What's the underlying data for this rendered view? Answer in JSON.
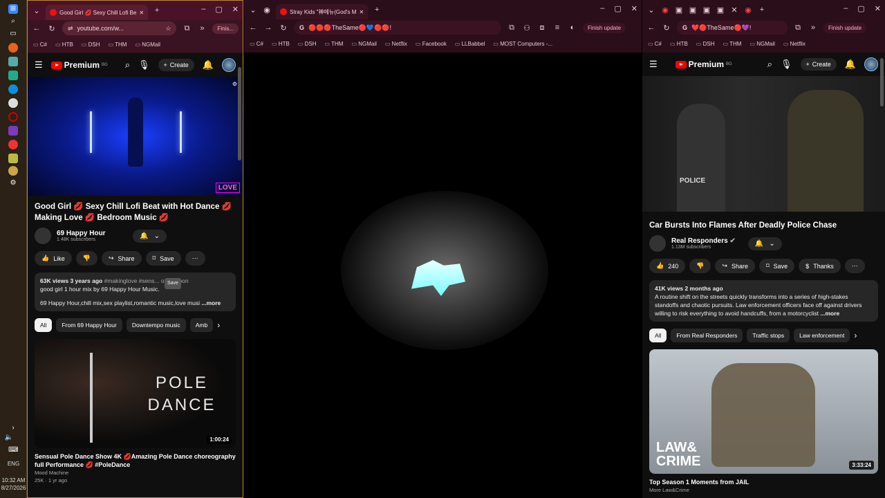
{
  "taskbar": {
    "time": "10:32 AM",
    "date": "8/27/2026",
    "lang": "ENG"
  },
  "win1": {
    "tab_title": "Good Girl 💋 Sexy Chill Lofi Be",
    "url": "youtube.com/w...",
    "finish": "Finis...",
    "bookmarks": [
      "C#",
      "HTB",
      "DSH",
      "THM",
      "NGMail"
    ],
    "brand": "Premium",
    "brand_sup": "BG",
    "create": "Create",
    "title": "Good Girl 💋 Sexy Chill Lofi Beat with Hot Dance 💋 Making Love 💋 Bedroom Music 💋",
    "channel": "69 Happy Hour",
    "subs": "1.48K subscribers",
    "like": "Like",
    "share": "Share",
    "save": "Save",
    "desc_stats": "63K views  3 years ago",
    "desc_tags": "#makinglove #sens... oneymoon",
    "desc_line2": "good girl 1 hour mix by 69 Happy Hour Music.",
    "desc_line3": "69 Happy Hour,chill mix,sex playlist,romantic music,love musi",
    "more": "...more",
    "chips": [
      "All",
      "From 69 Happy Hour",
      "Downtempo music",
      "Amb"
    ],
    "next": {
      "title": "Sensual Pole Dance Show 4K 💋Amazing Pole Dance choreography full Performance 💋 #PoleDance",
      "channel": "Mood Machine",
      "meta": "25K · 1 yr ago",
      "duration": "1:00:24",
      "thumb_text": "POLE DANCE"
    },
    "tooltip": "Save",
    "badge": "LOVE"
  },
  "win2": {
    "tab_title": "Stray Kids \"神메뉴(God's M",
    "omni": "🔴🔴🔴TheSame🔴💙🔴🔴!",
    "finish": "Finish update",
    "bookmarks": [
      "C#",
      "HTB",
      "DSH",
      "THM",
      "NGMail",
      "Netflix",
      "Facebook",
      "LLBabbel",
      "MOST Computers -..."
    ]
  },
  "win3": {
    "omni": "❤️🔴TheSame🔴💜!",
    "finish": "Finish update",
    "bookmarks": [
      "C#",
      "HTB",
      "DSH",
      "THM",
      "NGMail",
      "Netflix"
    ],
    "brand": "Premium",
    "brand_sup": "BG",
    "create": "Create",
    "title": "Car Bursts Into Flames After Deadly Police Chase",
    "channel": "Real Responders",
    "subs": "1.13M subscribers",
    "likes": "240",
    "share": "Share",
    "save": "Save",
    "thanks": "Thanks",
    "desc_stats": "41K views  2 months ago",
    "desc_text": "A routine shift on the streets quickly transforms into a series of high-stakes standoffs and chaotic pursuits. Law enforcement officers face off against drivers willing to risk everything to avoid handcuffs, from a motorcyclist",
    "more": "...more",
    "chips": [
      "All",
      "From Real Responders",
      "Traffic stops",
      "Law enforcement"
    ],
    "next": {
      "title": "Top Season 1 Moments from JAIL",
      "channel": "More Law&Crime",
      "duration": "3:33:24",
      "thumb_text": "LAW&\nCRIME"
    },
    "video_label": "POLICE"
  }
}
